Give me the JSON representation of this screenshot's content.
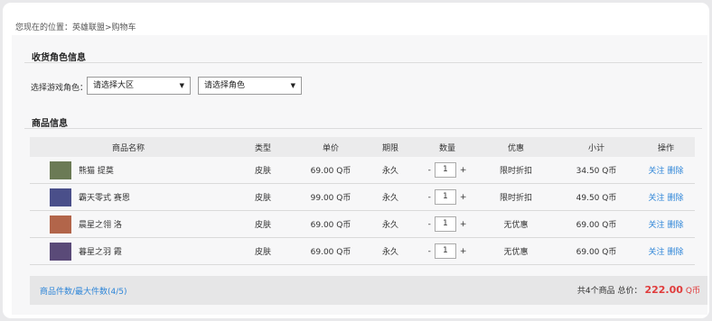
{
  "breadcrumb": "您现在的位置：英雄联盟>购物车",
  "recipient_section": {
    "title": "收货角色信息",
    "role_label": "选择游戏角色：",
    "region_select": "请选择大区",
    "role_select": "请选择角色"
  },
  "product_section": {
    "title": "商品信息",
    "headers": [
      "商品名称",
      "类型",
      "单价",
      "期限",
      "数量",
      "优惠",
      "小计",
      "操作"
    ],
    "rows": [
      {
        "name": "熊猫 提莫",
        "type": "皮肤",
        "price": "69.00 Q币",
        "term": "永久",
        "qty_minus": "-",
        "qty": "1",
        "qty_plus": "+",
        "discount": "限时折扣",
        "subtotal": "34.50 Q币",
        "follow": "关注",
        "delete": "删除",
        "thumb_color": "#6b7a55"
      },
      {
        "name": "霸天零式 赛恩",
        "type": "皮肤",
        "price": "99.00 Q币",
        "term": "永久",
        "qty_minus": "-",
        "qty": "1",
        "qty_plus": "+",
        "discount": "限时折扣",
        "subtotal": "49.50 Q币",
        "follow": "关注",
        "delete": "删除",
        "thumb_color": "#4a4f8a"
      },
      {
        "name": "晨星之翎 洛",
        "type": "皮肤",
        "price": "69.00 Q币",
        "term": "永久",
        "qty_minus": "-",
        "qty": "1",
        "qty_plus": "+",
        "discount": "无优惠",
        "subtotal": "69.00 Q币",
        "follow": "关注",
        "delete": "删除",
        "thumb_color": "#b2654a"
      },
      {
        "name": "暮星之羽 霞",
        "type": "皮肤",
        "price": "69.00 Q币",
        "term": "永久",
        "qty_minus": "-",
        "qty": "1",
        "qty_plus": "+",
        "discount": "无优惠",
        "subtotal": "69.00 Q币",
        "follow": "关注",
        "delete": "删除",
        "thumb_color": "#5a4a78"
      }
    ]
  },
  "footer": {
    "count_text": "商品件数/最大件数(4/5)",
    "total_prefix": "共4个商品 总价：",
    "total_amount": "222.00",
    "total_unit": "Q币"
  },
  "colors": {
    "link": "#2f86d8",
    "price_accent": "#e03c3c"
  }
}
